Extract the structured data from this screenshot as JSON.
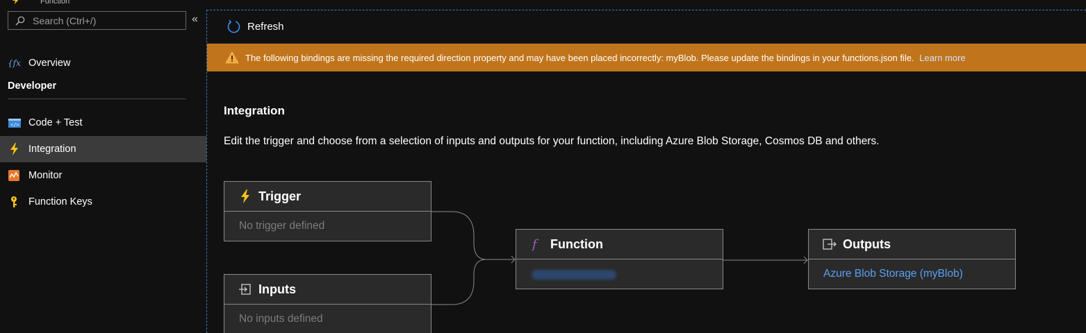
{
  "header": {
    "subtitle": "Function"
  },
  "sidebar": {
    "search": {
      "placeholder": "Search (Ctrl+/)"
    },
    "collapse_glyph": "«",
    "overview": {
      "label": "Overview",
      "icon": "function-fx-icon"
    },
    "section": "Developer",
    "items": [
      {
        "label": "Code + Test",
        "icon": "code-icon",
        "active": false
      },
      {
        "label": "Integration",
        "icon": "lightning-icon",
        "active": true
      },
      {
        "label": "Monitor",
        "icon": "monitor-icon",
        "active": false
      },
      {
        "label": "Function Keys",
        "icon": "key-icon",
        "active": false
      }
    ]
  },
  "toolbar": {
    "refresh_label": "Refresh"
  },
  "banner": {
    "message": "The following bindings are missing the required direction property and may have been placed incorrectly: myBlob. Please update the bindings in your functions.json file.",
    "link": "Learn more",
    "color": "#c0751c"
  },
  "main": {
    "title": "Integration",
    "description": "Edit the trigger and choose from a selection of inputs and outputs for your function, including Azure Blob Storage, Cosmos DB and others."
  },
  "cards": {
    "trigger": {
      "title": "Trigger",
      "value": "No trigger defined"
    },
    "inputs": {
      "title": "Inputs",
      "value": "No inputs defined"
    },
    "function": {
      "title": "Function",
      "value": ""
    },
    "outputs": {
      "title": "Outputs",
      "value": "Azure Blob Storage (myBlob)"
    }
  },
  "colors": {
    "accent_link": "#5aa0f2",
    "active_nav": "#3b3b3b",
    "bolt": "#f5c518"
  }
}
